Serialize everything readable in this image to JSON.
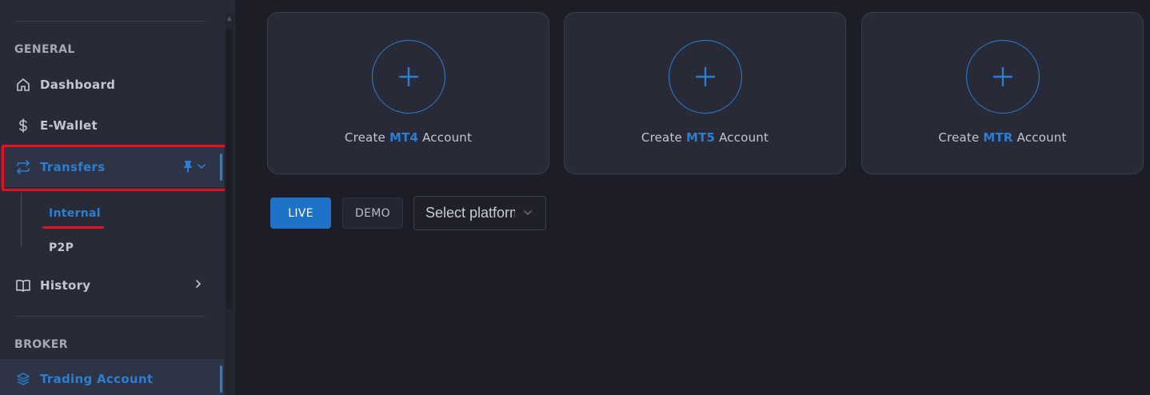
{
  "sidebar": {
    "general_title": "GENERAL",
    "items": {
      "dashboard": "Dashboard",
      "ewallet": "E-Wallet",
      "transfers": "Transfers",
      "history": "History"
    },
    "transfers_sub": {
      "internal": "Internal",
      "p2p": "P2P"
    },
    "broker_title": "BROKER",
    "trading_account": "Trading Account"
  },
  "cards": [
    {
      "prefix": "Create ",
      "platform": "MT4",
      "suffix": " Account"
    },
    {
      "prefix": "Create ",
      "platform": "MT5",
      "suffix": " Account"
    },
    {
      "prefix": "Create ",
      "platform": "MTR",
      "suffix": " Account"
    }
  ],
  "controls": {
    "live_label": "LIVE",
    "demo_label": "DEMO",
    "platform_select_value": "Select platform"
  },
  "colors": {
    "accent": "#2d7dd2",
    "highlight": "#e8101b",
    "sidebar_bg": "#282b37",
    "main_bg": "#1c1d26"
  },
  "icons": {
    "dashboard": "home-icon",
    "ewallet": "dollar-icon",
    "transfers": "transfer-arrows-icon",
    "history": "book-icon",
    "trading_account": "layers-icon"
  }
}
